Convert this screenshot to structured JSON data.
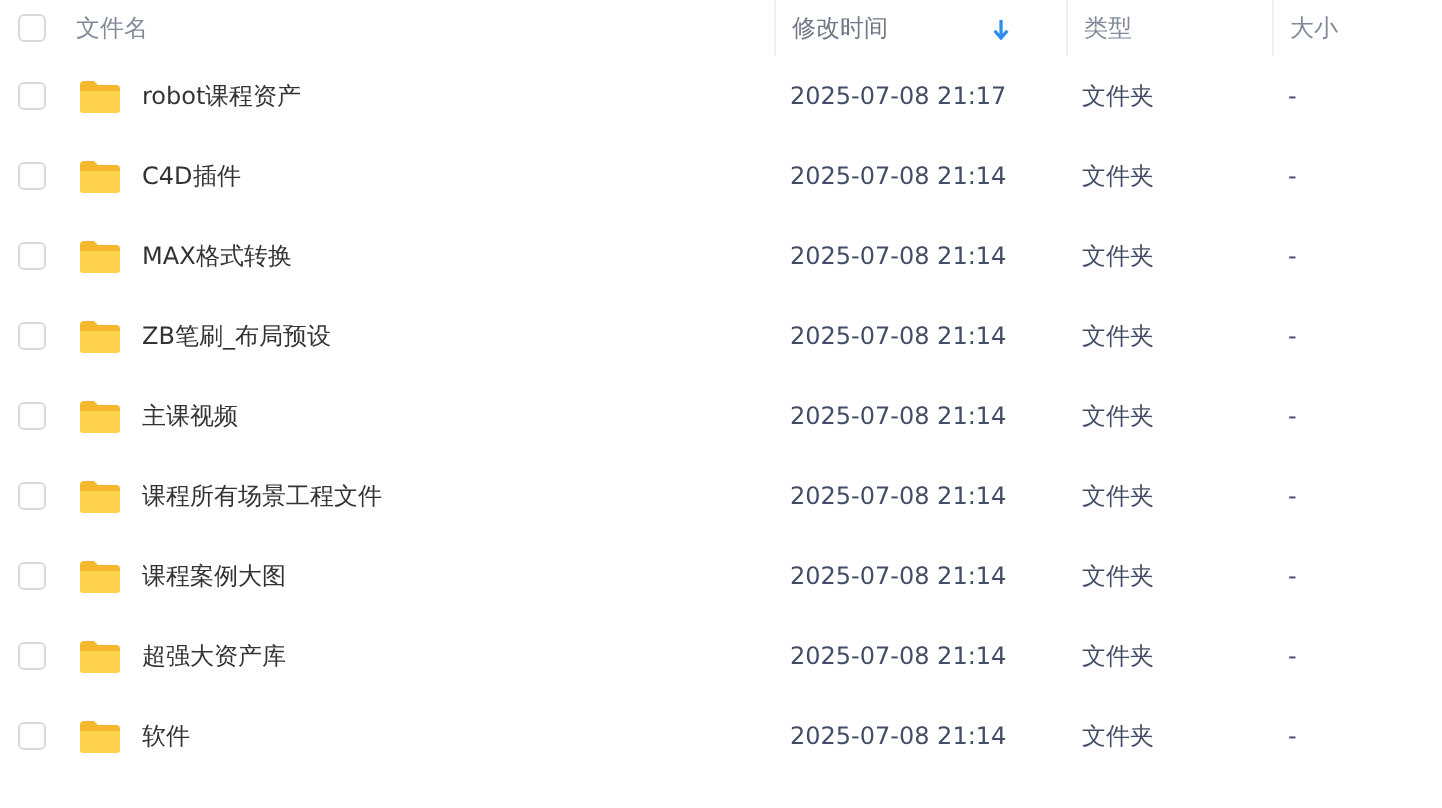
{
  "table": {
    "select_all": {
      "checked": false
    },
    "columns": [
      {
        "label": "文件名",
        "sorted": false
      },
      {
        "label": "修改时间",
        "sorted": true
      },
      {
        "label": "类型",
        "sorted": false
      },
      {
        "label": "大小",
        "sorted": false
      }
    ],
    "rows": [
      {
        "checked": false,
        "kind": "folder",
        "name": "robot课程资产",
        "modified": "2025-07-08 21:17",
        "type": "文件夹",
        "size": "-"
      },
      {
        "checked": false,
        "kind": "folder",
        "name": "C4D插件",
        "modified": "2025-07-08 21:14",
        "type": "文件夹",
        "size": "-"
      },
      {
        "checked": false,
        "kind": "folder",
        "name": "MAX格式转换",
        "modified": "2025-07-08 21:14",
        "type": "文件夹",
        "size": "-"
      },
      {
        "checked": false,
        "kind": "folder",
        "name": "ZB笔刷_布局预设",
        "modified": "2025-07-08 21:14",
        "type": "文件夹",
        "size": "-"
      },
      {
        "checked": false,
        "kind": "folder",
        "name": "主课视频",
        "modified": "2025-07-08 21:14",
        "type": "文件夹",
        "size": "-"
      },
      {
        "checked": false,
        "kind": "folder",
        "name": "课程所有场景工程文件",
        "modified": "2025-07-08 21:14",
        "type": "文件夹",
        "size": "-"
      },
      {
        "checked": false,
        "kind": "folder",
        "name": "课程案例大图",
        "modified": "2025-07-08 21:14",
        "type": "文件夹",
        "size": "-"
      },
      {
        "checked": false,
        "kind": "folder",
        "name": "超强大资产库",
        "modified": "2025-07-08 21:14",
        "type": "文件夹",
        "size": "-"
      },
      {
        "checked": false,
        "kind": "folder",
        "name": "软件",
        "modified": "2025-07-08 21:14",
        "type": "文件夹",
        "size": "-"
      }
    ]
  }
}
